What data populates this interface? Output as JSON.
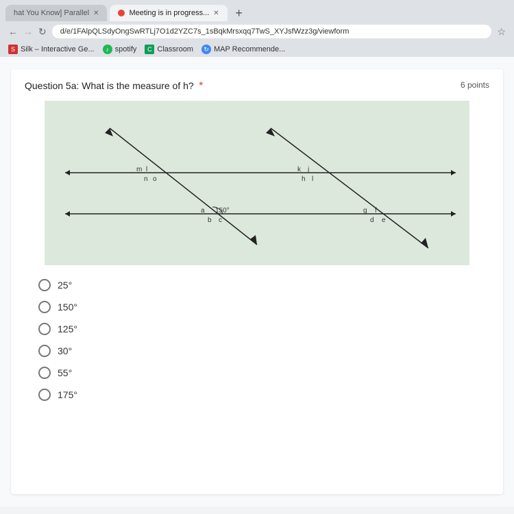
{
  "browser": {
    "tabs": [
      {
        "id": "tab1",
        "label": "hat You Know] Parallel",
        "active": false,
        "icon": "page-icon"
      },
      {
        "id": "tab2",
        "label": "Meeting is in progress...",
        "active": true,
        "icon": "meet-icon",
        "has_indicator": true
      }
    ],
    "address": "d/e/1FAlpQLSdyOngSwRTLj7O1d2YZC7s_1sBqkMrsxqq7TwS_XYJsfWzz3g/viewform",
    "bookmarks": [
      {
        "label": "Silk – Interactive Ge...",
        "icon": "silk-icon"
      },
      {
        "label": "spotify",
        "icon": "spotify-icon"
      },
      {
        "label": "Classroom",
        "icon": "classroom-icon"
      },
      {
        "label": "MAP Recommende...",
        "icon": "map-icon"
      }
    ]
  },
  "question": {
    "number": "5a",
    "text": "Question 5a: What is the measure of h?",
    "required": true,
    "points": "6 points",
    "diagram": {
      "angle_label": "150°",
      "labels": {
        "a": "a",
        "b": "b",
        "c": "c",
        "d": "d",
        "e": "e",
        "f": "f",
        "g": "g",
        "h": "h",
        "i": "i",
        "j": "j",
        "k": "k",
        "l": "l",
        "m": "m",
        "n": "n",
        "o": "o"
      }
    },
    "choices": [
      {
        "id": "c1",
        "value": "25°"
      },
      {
        "id": "c2",
        "value": "150°"
      },
      {
        "id": "c3",
        "value": "125°"
      },
      {
        "id": "c4",
        "value": "30°"
      },
      {
        "id": "c5",
        "value": "55°"
      },
      {
        "id": "c6",
        "value": "175°"
      }
    ]
  }
}
